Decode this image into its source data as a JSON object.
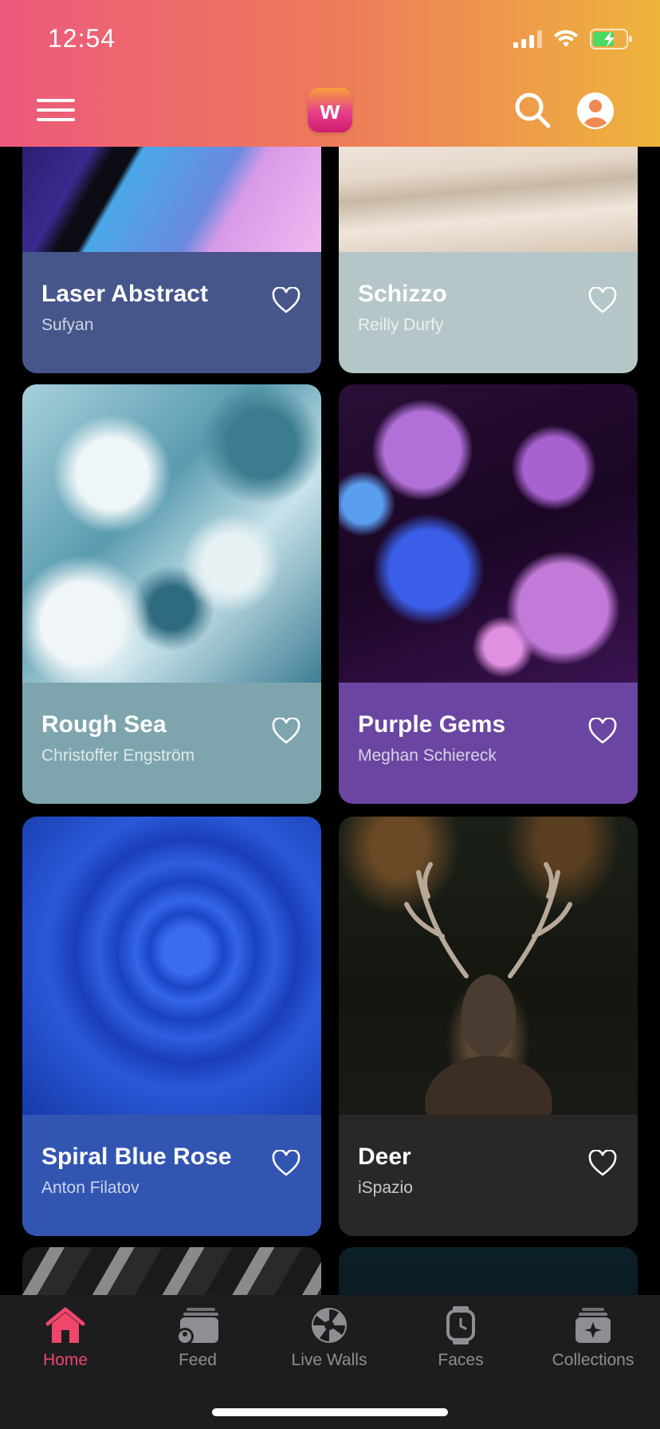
{
  "status": {
    "time": "12:54"
  },
  "header": {
    "logo_letter": "w",
    "colors": {
      "gradient_start": "#ec5a7c",
      "gradient_end": "#eeb43c"
    }
  },
  "cards": [
    {
      "title": "Laser Abstract",
      "author": "Sufyan",
      "color": "#46558a"
    },
    {
      "title": "Schizzo",
      "author": "Reilly Durfy",
      "color": "#b5c6c8"
    },
    {
      "title": "Rough Sea",
      "author": "Christoffer Engström",
      "color": "#7ea5ae"
    },
    {
      "title": "Purple Gems",
      "author": "Meghan Schiereck",
      "color": "#6a46a2"
    },
    {
      "title": "Spiral Blue Rose",
      "author": "Anton Filatov",
      "color": "#3355b2"
    },
    {
      "title": "Deer",
      "author": "iSpazio",
      "color": "#2a2826"
    }
  ],
  "tabs": [
    {
      "label": "Home",
      "icon": "home-icon",
      "active": true
    },
    {
      "label": "Feed",
      "icon": "feed-icon",
      "active": false
    },
    {
      "label": "Live Walls",
      "icon": "live-walls-icon",
      "active": false
    },
    {
      "label": "Faces",
      "icon": "watch-faces-icon",
      "active": false
    },
    {
      "label": "Collections",
      "icon": "collections-icon",
      "active": false
    }
  ],
  "accent_color": "#f0466b"
}
